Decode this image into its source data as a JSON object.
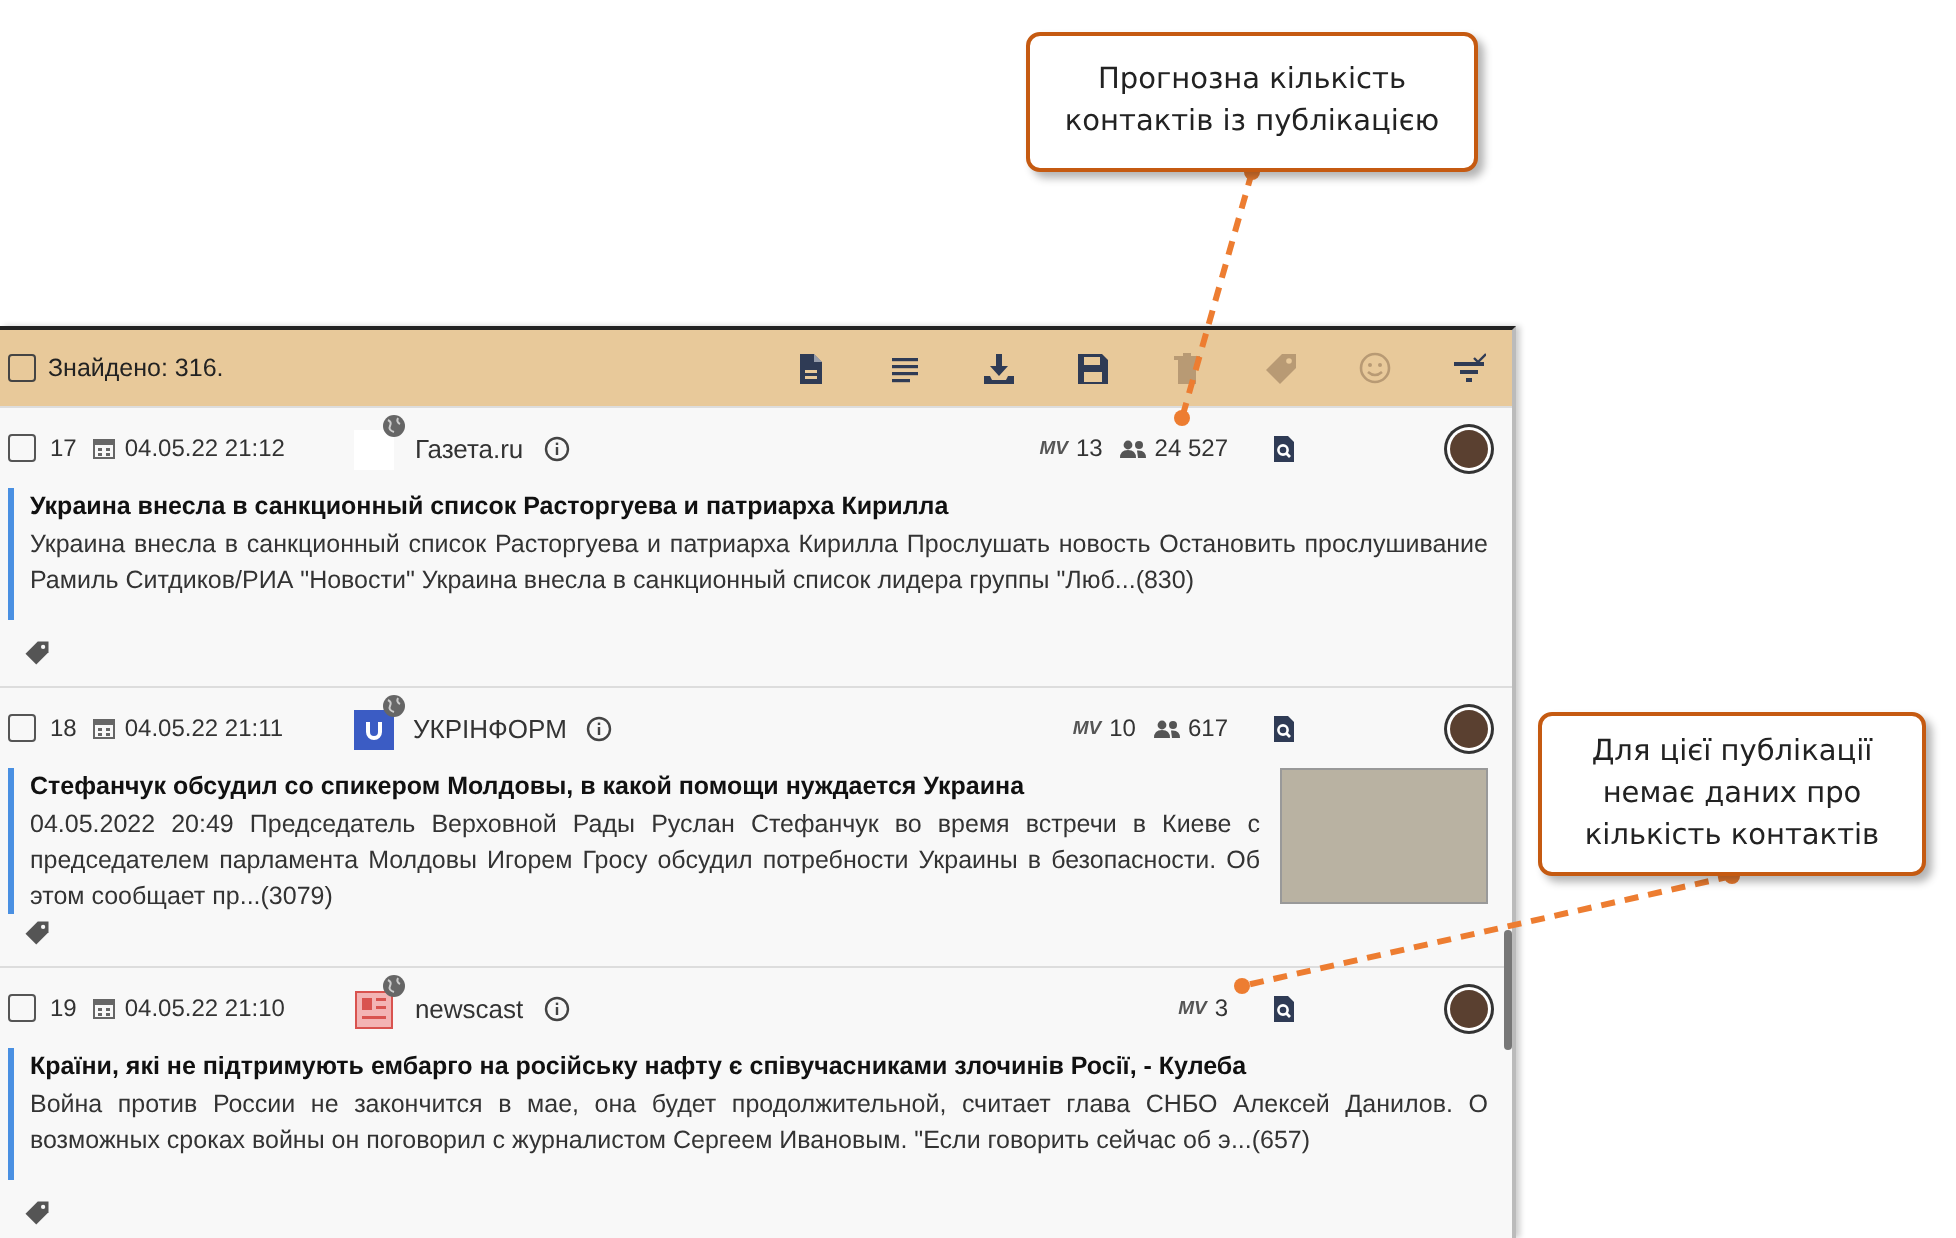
{
  "toolbar": {
    "checked": false,
    "found": "Знайдено: 316.",
    "actions": [
      {
        "kind": "document",
        "disabled": false
      },
      {
        "kind": "lines",
        "disabled": false
      },
      {
        "kind": "download",
        "disabled": false
      },
      {
        "kind": "save",
        "disabled": false
      },
      {
        "kind": "delete",
        "disabled": true
      },
      {
        "kind": "tag",
        "disabled": true
      },
      {
        "kind": "smiley",
        "disabled": true
      },
      {
        "kind": "filter",
        "disabled": false
      }
    ]
  },
  "items": [
    {
      "checked": false,
      "number": "17",
      "date": "04.05.22 21:12",
      "logo": {
        "kind": "blank"
      },
      "source": "Газета.ru",
      "mv_label": "MV",
      "mv": "13",
      "contacts": "24 527",
      "title": "Украина внесла в санкционный список Расторгуева и патриарха Кирилла",
      "text": "Украина внесла в санкционный список Расторгуева и патриарха Кирилла Прослушать новость Остановить прослушивание Рамиль Ситдиков/РИА \"Новости\" Украина внесла в санкционный список лидера группы \"Люб...(830)",
      "image": false
    },
    {
      "checked": false,
      "number": "18",
      "date": "04.05.22 21:11",
      "logo": {
        "kind": "ukrinform"
      },
      "source": "УКРІНФОРМ",
      "mv_label": "MV",
      "mv": "10",
      "contacts": "617",
      "title": "Стефанчук обсудил со спикером Молдовы, в какой помощи нуждается Украина",
      "text": "04.05.2022 20:49 Председатель Верховной Рады Руслан Стефанчук во время встречи в Киеве с председателем парламента Молдовы Игорем Гросу обсудил потребности Украины в безопасности. Об этом сообщает пр...(3079)",
      "image": true
    },
    {
      "checked": false,
      "number": "19",
      "date": "04.05.22 21:10",
      "logo": {
        "kind": "newscast"
      },
      "source": "newscast",
      "mv_label": "MV",
      "mv": "3",
      "title": "Країни, які не підтримують ембарго на російську нафту є співучасниками злочинів Росії, - Кулеба",
      "text": "Война против России не закончится в мае, она будет продолжительной, считает глава СНБО Алексей Данилов. О возможных сроках войны он поговорил с журналистом Сергеем Ивановым. \"Если говорить сейчас об э...(657)",
      "image": false
    }
  ],
  "callouts": [
    {
      "text": "Прогнозна кількість контактів із публікацією"
    },
    {
      "text": "Для цієї публікації немає даних про кількість контактів"
    }
  ]
}
